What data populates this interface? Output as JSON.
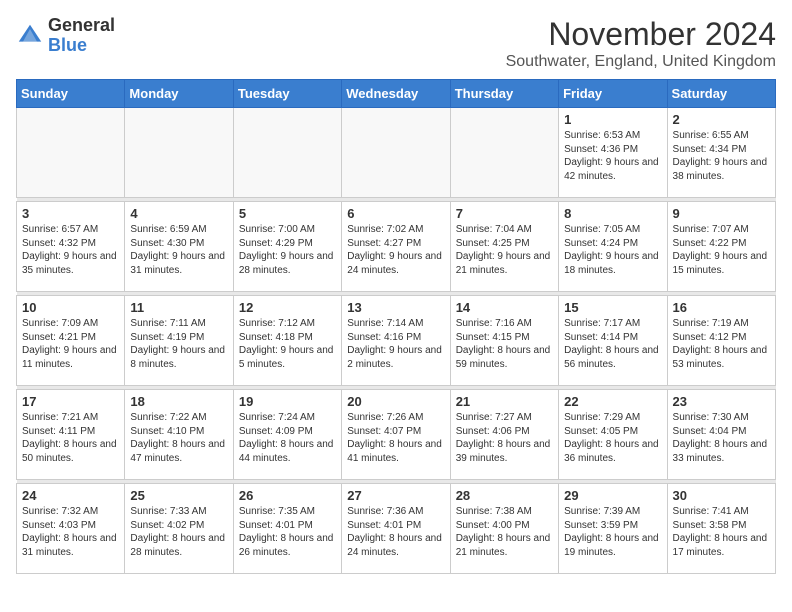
{
  "header": {
    "logo": {
      "general": "General",
      "blue": "Blue"
    },
    "title": "November 2024",
    "location": "Southwater, England, United Kingdom"
  },
  "weekdays": [
    "Sunday",
    "Monday",
    "Tuesday",
    "Wednesday",
    "Thursday",
    "Friday",
    "Saturday"
  ],
  "weeks": [
    [
      {
        "day": "",
        "info": ""
      },
      {
        "day": "",
        "info": ""
      },
      {
        "day": "",
        "info": ""
      },
      {
        "day": "",
        "info": ""
      },
      {
        "day": "",
        "info": ""
      },
      {
        "day": "1",
        "info": "Sunrise: 6:53 AM\nSunset: 4:36 PM\nDaylight: 9 hours\nand 42 minutes."
      },
      {
        "day": "2",
        "info": "Sunrise: 6:55 AM\nSunset: 4:34 PM\nDaylight: 9 hours\nand 38 minutes."
      }
    ],
    [
      {
        "day": "3",
        "info": "Sunrise: 6:57 AM\nSunset: 4:32 PM\nDaylight: 9 hours\nand 35 minutes."
      },
      {
        "day": "4",
        "info": "Sunrise: 6:59 AM\nSunset: 4:30 PM\nDaylight: 9 hours\nand 31 minutes."
      },
      {
        "day": "5",
        "info": "Sunrise: 7:00 AM\nSunset: 4:29 PM\nDaylight: 9 hours\nand 28 minutes."
      },
      {
        "day": "6",
        "info": "Sunrise: 7:02 AM\nSunset: 4:27 PM\nDaylight: 9 hours\nand 24 minutes."
      },
      {
        "day": "7",
        "info": "Sunrise: 7:04 AM\nSunset: 4:25 PM\nDaylight: 9 hours\nand 21 minutes."
      },
      {
        "day": "8",
        "info": "Sunrise: 7:05 AM\nSunset: 4:24 PM\nDaylight: 9 hours\nand 18 minutes."
      },
      {
        "day": "9",
        "info": "Sunrise: 7:07 AM\nSunset: 4:22 PM\nDaylight: 9 hours\nand 15 minutes."
      }
    ],
    [
      {
        "day": "10",
        "info": "Sunrise: 7:09 AM\nSunset: 4:21 PM\nDaylight: 9 hours\nand 11 minutes."
      },
      {
        "day": "11",
        "info": "Sunrise: 7:11 AM\nSunset: 4:19 PM\nDaylight: 9 hours\nand 8 minutes."
      },
      {
        "day": "12",
        "info": "Sunrise: 7:12 AM\nSunset: 4:18 PM\nDaylight: 9 hours\nand 5 minutes."
      },
      {
        "day": "13",
        "info": "Sunrise: 7:14 AM\nSunset: 4:16 PM\nDaylight: 9 hours\nand 2 minutes."
      },
      {
        "day": "14",
        "info": "Sunrise: 7:16 AM\nSunset: 4:15 PM\nDaylight: 8 hours\nand 59 minutes."
      },
      {
        "day": "15",
        "info": "Sunrise: 7:17 AM\nSunset: 4:14 PM\nDaylight: 8 hours\nand 56 minutes."
      },
      {
        "day": "16",
        "info": "Sunrise: 7:19 AM\nSunset: 4:12 PM\nDaylight: 8 hours\nand 53 minutes."
      }
    ],
    [
      {
        "day": "17",
        "info": "Sunrise: 7:21 AM\nSunset: 4:11 PM\nDaylight: 8 hours\nand 50 minutes."
      },
      {
        "day": "18",
        "info": "Sunrise: 7:22 AM\nSunset: 4:10 PM\nDaylight: 8 hours\nand 47 minutes."
      },
      {
        "day": "19",
        "info": "Sunrise: 7:24 AM\nSunset: 4:09 PM\nDaylight: 8 hours\nand 44 minutes."
      },
      {
        "day": "20",
        "info": "Sunrise: 7:26 AM\nSunset: 4:07 PM\nDaylight: 8 hours\nand 41 minutes."
      },
      {
        "day": "21",
        "info": "Sunrise: 7:27 AM\nSunset: 4:06 PM\nDaylight: 8 hours\nand 39 minutes."
      },
      {
        "day": "22",
        "info": "Sunrise: 7:29 AM\nSunset: 4:05 PM\nDaylight: 8 hours\nand 36 minutes."
      },
      {
        "day": "23",
        "info": "Sunrise: 7:30 AM\nSunset: 4:04 PM\nDaylight: 8 hours\nand 33 minutes."
      }
    ],
    [
      {
        "day": "24",
        "info": "Sunrise: 7:32 AM\nSunset: 4:03 PM\nDaylight: 8 hours\nand 31 minutes."
      },
      {
        "day": "25",
        "info": "Sunrise: 7:33 AM\nSunset: 4:02 PM\nDaylight: 8 hours\nand 28 minutes."
      },
      {
        "day": "26",
        "info": "Sunrise: 7:35 AM\nSunset: 4:01 PM\nDaylight: 8 hours\nand 26 minutes."
      },
      {
        "day": "27",
        "info": "Sunrise: 7:36 AM\nSunset: 4:01 PM\nDaylight: 8 hours\nand 24 minutes."
      },
      {
        "day": "28",
        "info": "Sunrise: 7:38 AM\nSunset: 4:00 PM\nDaylight: 8 hours\nand 21 minutes."
      },
      {
        "day": "29",
        "info": "Sunrise: 7:39 AM\nSunset: 3:59 PM\nDaylight: 8 hours\nand 19 minutes."
      },
      {
        "day": "30",
        "info": "Sunrise: 7:41 AM\nSunset: 3:58 PM\nDaylight: 8 hours\nand 17 minutes."
      }
    ]
  ]
}
